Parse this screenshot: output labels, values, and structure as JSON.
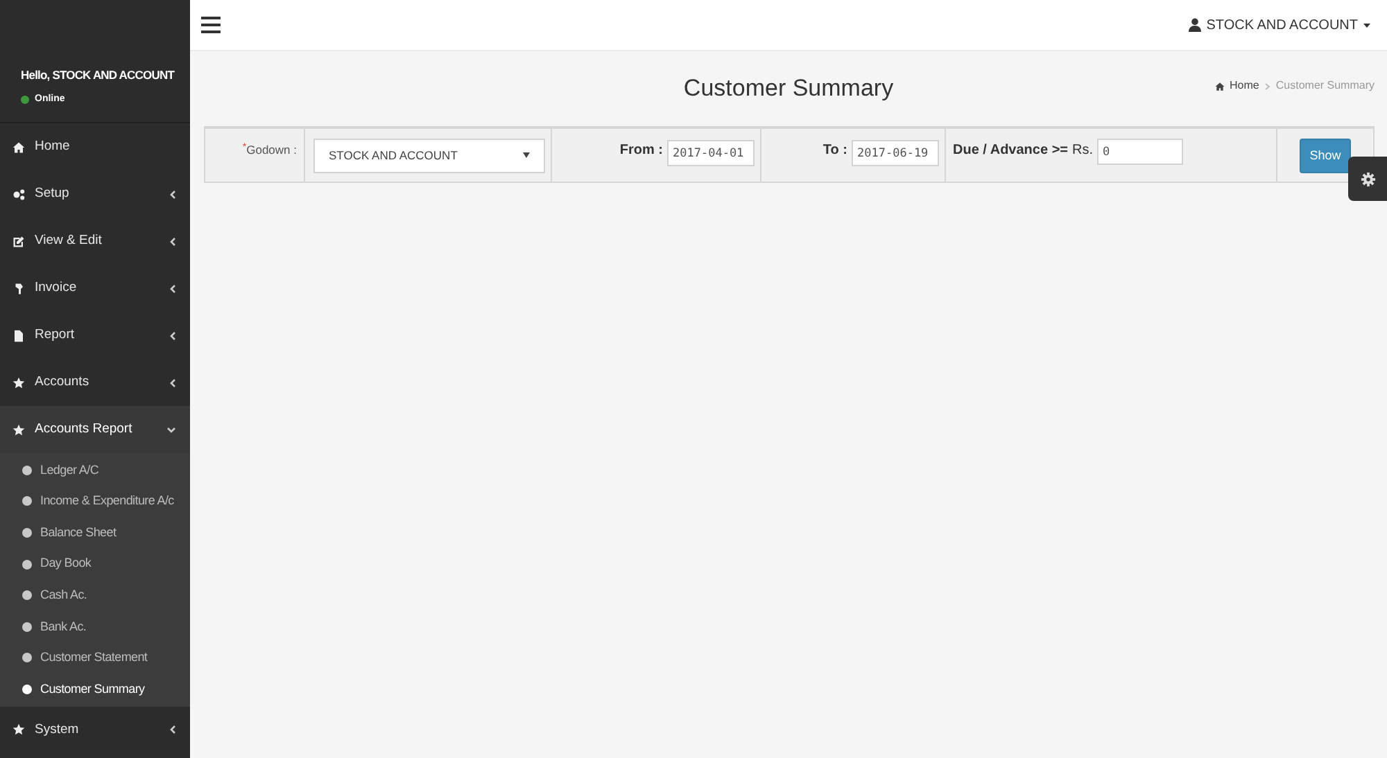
{
  "sidebar": {
    "greeting": "Hello, STOCK AND ACCOUNT",
    "status": {
      "label": "Online",
      "color": "#3c9a3c"
    },
    "items": [
      {
        "label": "Home",
        "kind": "link"
      },
      {
        "label": "Setup",
        "kind": "menu",
        "expanded": false
      },
      {
        "label": "View & Edit",
        "kind": "menu",
        "expanded": false
      },
      {
        "label": "Invoice",
        "kind": "menu",
        "expanded": false
      },
      {
        "label": "Report",
        "kind": "menu",
        "expanded": false
      },
      {
        "label": "Accounts",
        "kind": "menu",
        "expanded": false
      },
      {
        "label": "Accounts Report",
        "kind": "menu",
        "expanded": true,
        "children": [
          {
            "label": "Ledger A/C",
            "selected": false
          },
          {
            "label": "Income & Expenditure A/c",
            "selected": false
          },
          {
            "label": "Balance Sheet",
            "selected": false
          },
          {
            "label": "Day Book",
            "selected": false
          },
          {
            "label": "Cash Ac.",
            "selected": false
          },
          {
            "label": "Bank Ac.",
            "selected": false
          },
          {
            "label": "Customer Statement",
            "selected": false
          },
          {
            "label": "Customer Summary",
            "selected": true
          }
        ]
      },
      {
        "label": "System",
        "kind": "menu",
        "expanded": false
      }
    ]
  },
  "header": {
    "user": "STOCK AND ACCOUNT"
  },
  "page": {
    "title": "Customer Summary",
    "breadcrumb": [
      "Home",
      "Customer Summary"
    ]
  },
  "filter": {
    "godown": {
      "required_mark": "*",
      "label": "Godown :",
      "value": "STOCK AND ACCOUNT"
    },
    "from": {
      "label": "From :",
      "value": "2017-04-01"
    },
    "to": {
      "label": "To :",
      "value": "2017-06-19"
    },
    "due": {
      "label": "Due / Advance >=",
      "prefix": "Rs.",
      "value": "0"
    },
    "button": "Show"
  }
}
